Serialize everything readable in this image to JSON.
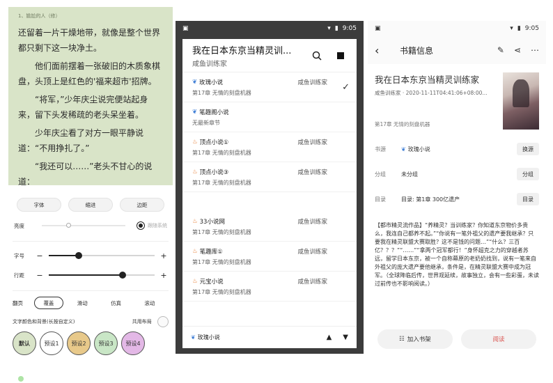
{
  "reader": {
    "chapter_header": "1、尴尬的人（修）",
    "paragraphs": [
      "还留着一片干燥地带，就像是整个世界都只剩下这一块净土。",
      "他们面前摆着一张破旧的木质象棋盘，头顶上是红色的'福来超市'招牌。",
      "“将军，”少年庆尘说完便站起身来，留下头发稀疏的老头呆坐着。",
      "少年庆尘看了对方一眼平静说道：“不用挣扎了。”",
      "“我还可以……”老头不甘心的说道："
    ]
  },
  "settings": {
    "top_buttons": [
      "字体",
      "缩进",
      "边距"
    ],
    "brightness_label": "亮度",
    "brightness_follow": "跟随系统",
    "brightness_level": 0.33,
    "size_label": "字号",
    "size_level": 0.28,
    "spacing_label": "行距",
    "spacing_level": 0.7,
    "minus": "−",
    "plus": "+",
    "turn_label": "翻页",
    "turn_modes": [
      "覆盖",
      "滑动",
      "仿真",
      "滚动"
    ],
    "color_label": "文字颜色和背景(长按自定义)",
    "share_layout": "共用布局",
    "presets": [
      {
        "label": "默认",
        "color": "#d9e4c8"
      },
      {
        "label": "预设1",
        "color": "#ffffff"
      },
      {
        "label": "预设2",
        "color": "#e8c98a"
      },
      {
        "label": "预设3",
        "color": "#c9e6c6"
      },
      {
        "label": "预设4",
        "color": "#e3b8e6"
      }
    ]
  },
  "statusbar": {
    "time": "9:05"
  },
  "switch_dialog": {
    "title": "我在日本东京当精灵训...",
    "subtitle": "咸鱼训练家",
    "sources": [
      {
        "name": "玫瑰小说",
        "author": "咸鱼训练家",
        "chapter": "第17章 无情的刻盘机器",
        "checked": true,
        "icon": "rose"
      },
      {
        "name": "笔趣阁小说",
        "author": "",
        "chapter": "无最新章节",
        "checked": false,
        "icon": "rose"
      },
      {
        "name": "顶点小说①",
        "author": "咸鱼训练家",
        "chapter": "第17章 无情的刻盘机器",
        "checked": false,
        "icon": "flame"
      },
      {
        "name": "顶点小说③",
        "author": "咸鱼训练家",
        "chapter": "第17章 无情的刻盘机器",
        "checked": false,
        "icon": "flame"
      },
      {
        "name": "33小说网",
        "author": "咸鱼训练家",
        "chapter": "第17章 无情的刻盘机器",
        "checked": false,
        "icon": "flame"
      },
      {
        "name": "笔趣库①",
        "author": "咸鱼训练家",
        "chapter": "第17章 无情的刻盘机器",
        "checked": false,
        "icon": "flame"
      },
      {
        "name": "元宝小说",
        "author": "咸鱼训练家",
        "chapter": "第17章 无情的刻盘机器",
        "checked": false,
        "icon": "flame"
      }
    ],
    "footer_source": "玫瑰小说"
  },
  "book_info": {
    "page_title": "书籍信息",
    "title": "我在日本东京当精灵训练家",
    "meta": "咸鱼训练家 · 2020-11-11T04:41:06+08:00...",
    "latest": "第17章 无情的刻盘机器",
    "source_label": "书源",
    "source_value": "玫瑰小说",
    "source_btn": "换源",
    "group_label": "分组",
    "group_value": "未分组",
    "group_btn": "分组",
    "toc_label": "目录",
    "toc_value": "目录: 第1章 300亿遗产",
    "toc_btn": "目录",
    "intro": "【都市精灵流作品】“养精灵？当训练家？你知道东京物价多贵么，我连自己都养不起。”“你说有一笔外祖父的遗产要我继承？只要我在精灵联盟大赛取胜？这不是钱的问题…”“什么？三百亿？？？”“……”“拿两个冠军都行！”身怀超克之力的穿越者苏远，留学日本东京，被一个自称幕原的老奶奶找到，说有一笔来自外祖父的庞大遗产要他继承，条件是，在精灵联盟大赛中成为冠军。（全球降临后传，世界观延续，故事独立，会有一些彩蛋，未读过前传也不影响阅读。）",
    "add_shelf": "加入书架",
    "read": "阅读"
  }
}
